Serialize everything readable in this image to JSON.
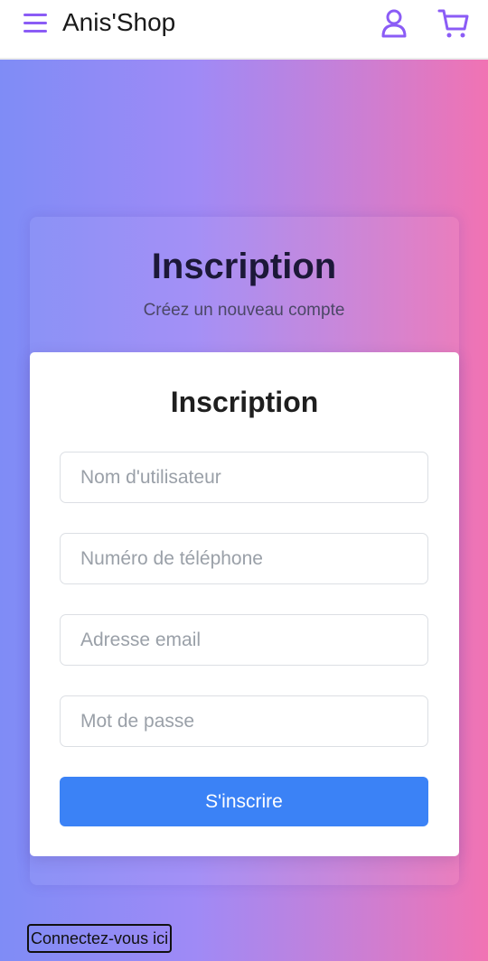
{
  "header": {
    "brand": "Anis'Shop",
    "accent_color": "#8b5cf6",
    "icons": [
      "menu-icon",
      "user-icon",
      "cart-icon"
    ]
  },
  "hero": {
    "title": "Inscription",
    "subtitle": "Créez un nouveau compte"
  },
  "form": {
    "title": "Inscription",
    "fields": {
      "username": {
        "placeholder": "Nom d'utilisateur",
        "value": ""
      },
      "phone": {
        "placeholder": "Numéro de téléphone",
        "value": ""
      },
      "email": {
        "placeholder": "Adresse email",
        "value": ""
      },
      "password": {
        "placeholder": "Mot de passe",
        "value": ""
      }
    },
    "submit_label": "S'inscrire",
    "submit_color": "#3b82f6"
  },
  "footer": {
    "login_link": "Connectez-vous ici"
  }
}
